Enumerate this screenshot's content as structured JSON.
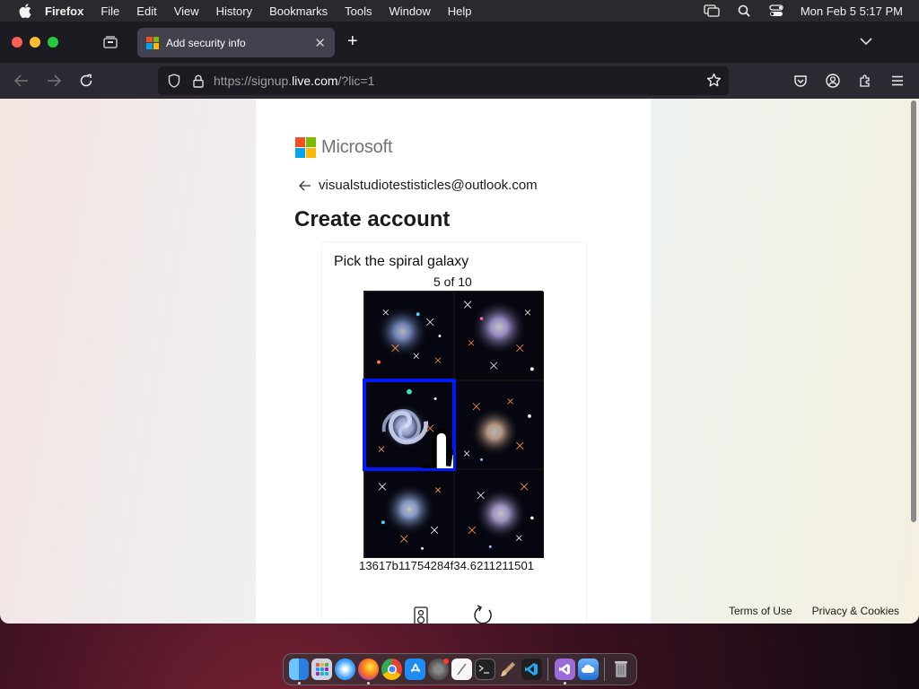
{
  "menubar": {
    "app": "Firefox",
    "items": [
      "File",
      "Edit",
      "View",
      "History",
      "Bookmarks",
      "Tools",
      "Window",
      "Help"
    ],
    "clock": "Mon Feb 5  5:17 PM"
  },
  "browser": {
    "tab_title": "Add security info",
    "url_prefix": "https://signup.",
    "url_domain": "live.com",
    "url_suffix": "/?lic=1"
  },
  "page": {
    "brand": "Microsoft",
    "email": "visualstudiotestisticles@outlook.com",
    "heading": "Create account",
    "challenge": {
      "prompt": "Pick the spiral galaxy",
      "progress": "5 of 10",
      "session_id": "13617b11754284f34.6211211501",
      "selected_index": 2
    },
    "footer": {
      "terms": "Terms of Use",
      "privacy": "Privacy & Cookies"
    }
  },
  "colors": {
    "accent_selected": "#0019ff",
    "ms_red": "#f25022",
    "ms_green": "#7fba00",
    "ms_blue": "#00a4ef",
    "ms_yellow": "#ffb900"
  },
  "dock": {
    "apps": [
      "finder-icon",
      "launchpad-icon",
      "safari-icon",
      "firefox-icon",
      "chrome-icon",
      "app-store-icon",
      "system-settings-icon",
      "textedit-icon",
      "terminal-icon",
      "brush-icon",
      "vscode-icon",
      "visual-studio-icon",
      "cloud-icon",
      "trash-icon"
    ]
  }
}
